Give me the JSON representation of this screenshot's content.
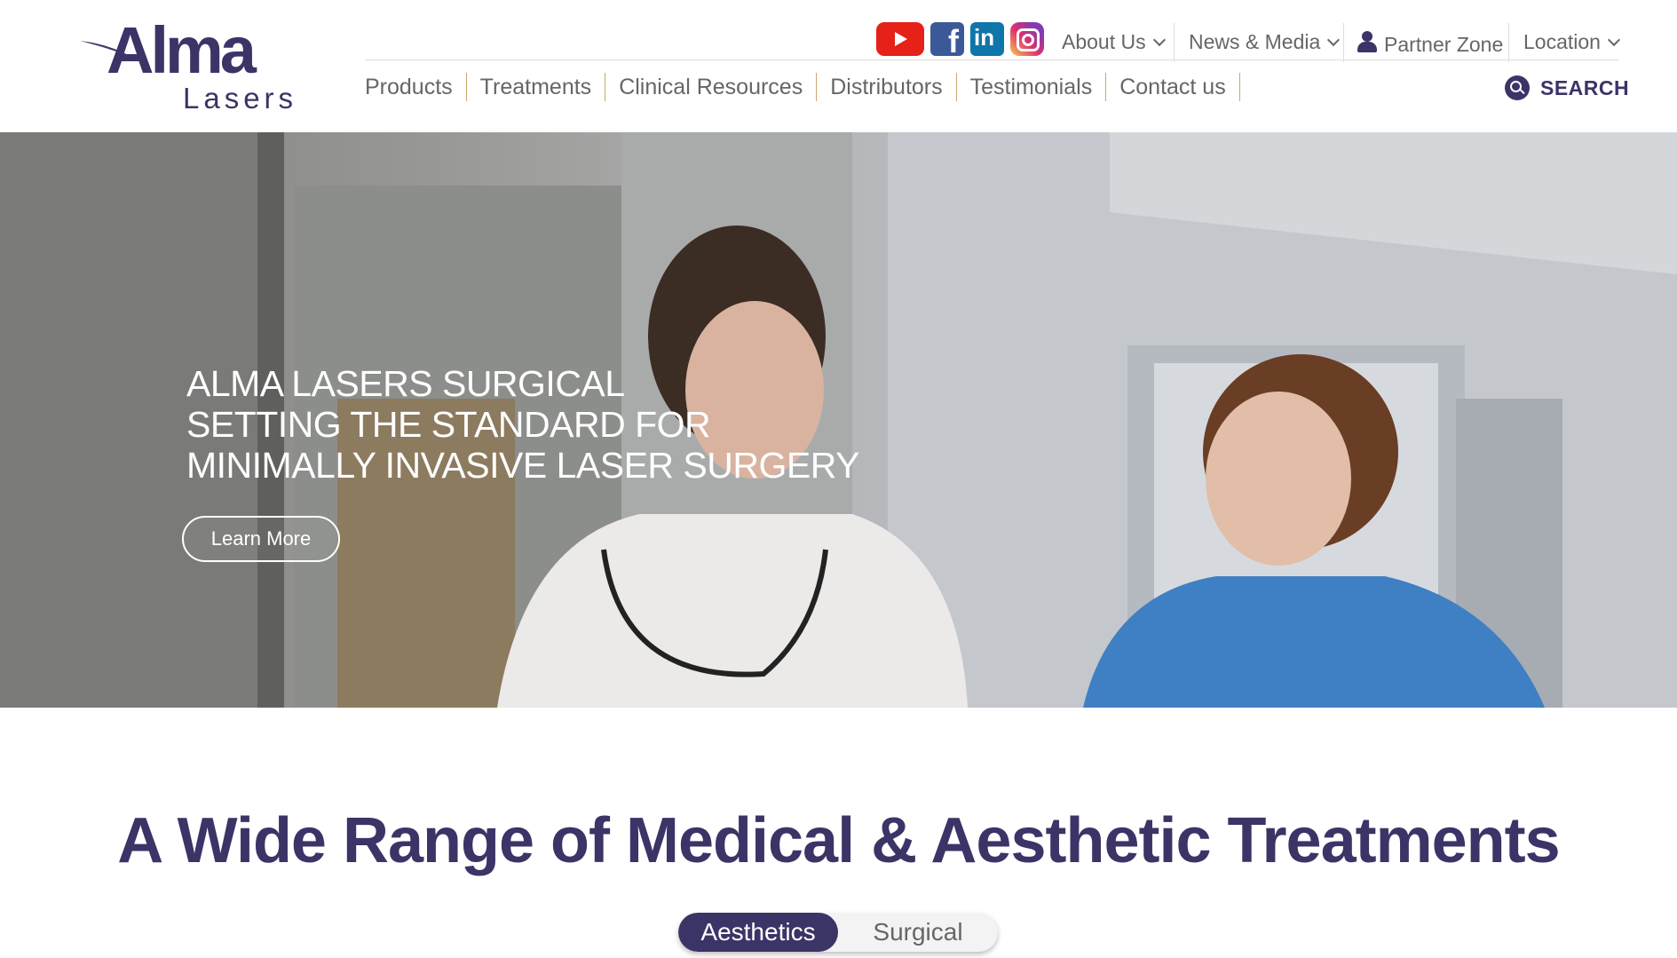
{
  "logo": {
    "brand": "Alma",
    "sub": "Lasers"
  },
  "social": [
    {
      "icon": "youtube-icon"
    },
    {
      "icon": "facebook-icon",
      "glyph": "f"
    },
    {
      "icon": "linkedin-icon",
      "glyph": "in"
    },
    {
      "icon": "instagram-icon"
    }
  ],
  "utility_nav": {
    "about": "About Us",
    "news": "News & Media",
    "partner": "Partner Zone",
    "location": "Location"
  },
  "main_nav": [
    "Products",
    "Treatments",
    "Clinical Resources",
    "Distributors",
    "Testimonials",
    "Contact us"
  ],
  "search": {
    "label": "SEARCH"
  },
  "hero": {
    "lines": [
      "ALMA LASERS SURGICAL",
      "SETTING THE STANDARD FOR",
      "MINIMALLY INVASIVE LASER SURGERY"
    ],
    "cta": "Learn More"
  },
  "section": {
    "title": "A Wide Range of Medical & Aesthetic Treatments",
    "tabs": [
      "Aesthetics",
      "Surgical"
    ]
  },
  "colors": {
    "brand": "#3b3467",
    "divider": "#c9a86a"
  }
}
